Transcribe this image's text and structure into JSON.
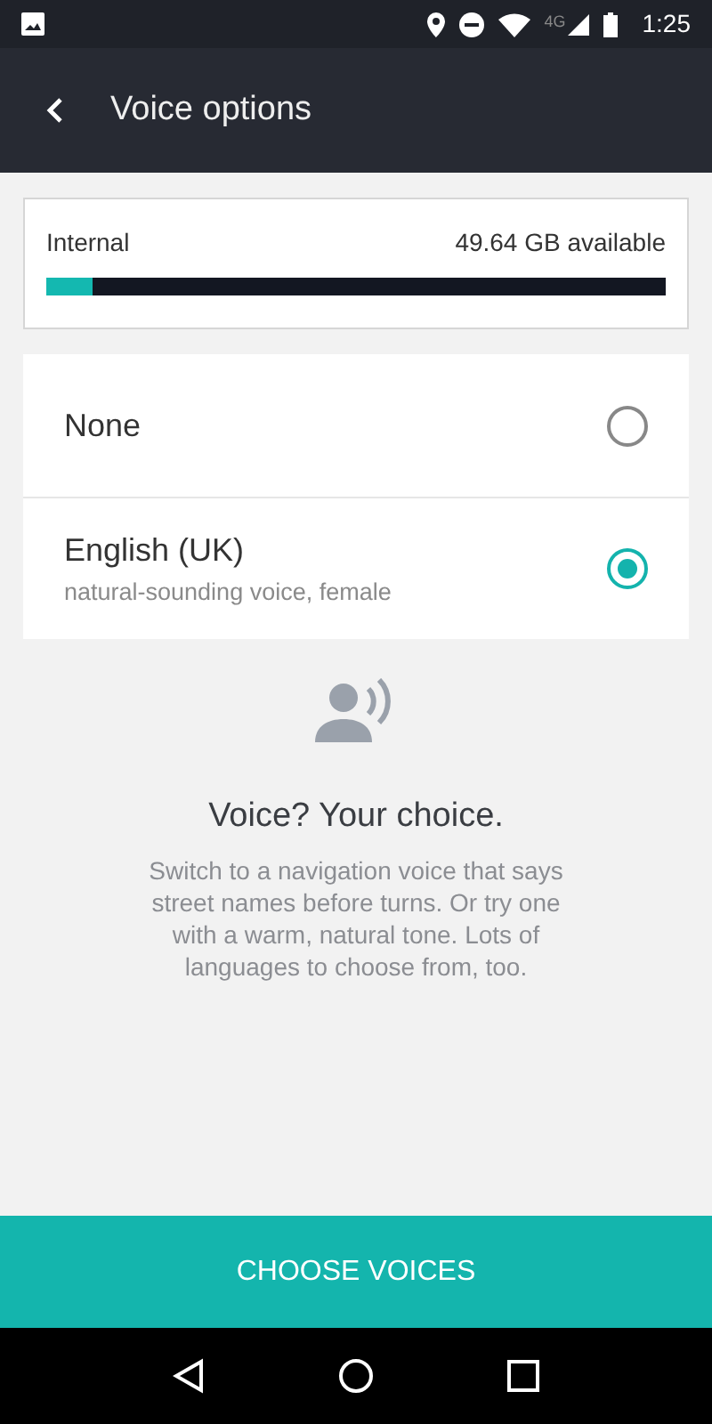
{
  "status_bar": {
    "network": "4G",
    "time": "1:25"
  },
  "header": {
    "title": "Voice options"
  },
  "storage": {
    "label": "Internal",
    "available": "49.64 GB available",
    "level": 0.075
  },
  "voices": [
    {
      "name": "None",
      "selected": false
    },
    {
      "name": "English (UK)",
      "description": "natural-sounding voice, female",
      "selected": true
    }
  ],
  "empty_state": {
    "title": "Voice? Your choice.",
    "body": "Switch to a navigation voice that says street names before turns. Or try one with a warm, natural tone. Lots of languages to choose from, too."
  },
  "action_button": "CHOOSE VOICES"
}
